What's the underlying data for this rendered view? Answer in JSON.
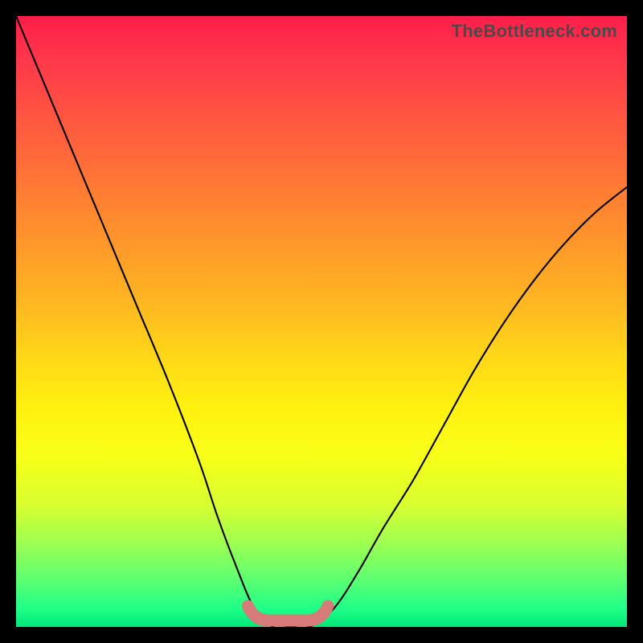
{
  "watermark": "TheBottleneck.com",
  "chart_data": {
    "type": "line",
    "title": "",
    "xlabel": "",
    "ylabel": "",
    "x": [
      0.0,
      0.05,
      0.1,
      0.15,
      0.2,
      0.25,
      0.3,
      0.33,
      0.36,
      0.39,
      0.42,
      0.45,
      0.48,
      0.52,
      0.56,
      0.6,
      0.65,
      0.7,
      0.75,
      0.8,
      0.85,
      0.9,
      0.95,
      1.0
    ],
    "values": [
      1.0,
      0.88,
      0.76,
      0.64,
      0.52,
      0.4,
      0.27,
      0.18,
      0.1,
      0.03,
      0.0,
      0.0,
      0.0,
      0.03,
      0.09,
      0.16,
      0.24,
      0.33,
      0.42,
      0.5,
      0.57,
      0.63,
      0.68,
      0.72
    ],
    "xlim": [
      0,
      1
    ],
    "ylim": [
      0,
      1
    ],
    "flat_segment": {
      "x_start": 0.39,
      "x_end": 0.5,
      "y": 0.0
    },
    "highlight_color": "#d67a7a",
    "curve_color": "#000000",
    "gradient_stops": [
      {
        "pos": 0.0,
        "color": "#ff1e4a"
      },
      {
        "pos": 0.5,
        "color": "#ffd818"
      },
      {
        "pos": 0.8,
        "color": "#d8ff30"
      },
      {
        "pos": 1.0,
        "color": "#00e878"
      }
    ]
  }
}
